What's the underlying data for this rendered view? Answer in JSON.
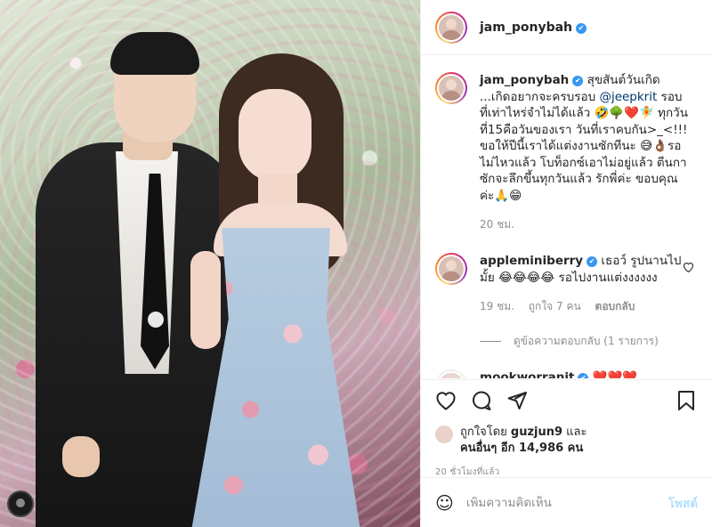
{
  "post": {
    "username": "jam_ponybah",
    "verified_mark": "✔"
  },
  "caption": {
    "username": "jam_ponybah",
    "text_before": " สุขสันต์วันเกิด ...เกิดอยากจะครบรอบ ",
    "mention": "@jeepkrit",
    "text_after": " รอบที่เท่าไหร่จำไม่ได้แล้ว 🤣🌳❤️🧚 ทุกวันที่15คือวันของเรา วันที่เราคบกัน>_<!!! ขอให้ปีนี้เราได้แต่งงานซักทีนะ 😅👌🏾รอไม่ไหวแล้ว โบท็อกซ์เอาไม่อยู่แล้ว ตีนกาซักจะลึกขึ้นทุกวันแล้ว รักพี่ค่ะ ขอบคุณค่ะ🙏😁",
    "time": "20 ชม."
  },
  "comments": [
    {
      "username": "appleminiberry",
      "text": " เธอว์ รูปนานไปมั้ย 😂😂😂😂 รอไปงานแต่งงงงงง",
      "time": "19 ชม.",
      "likes": "ถูกใจ 7 คน",
      "reply": "ตอบกลับ",
      "view_replies": "ดูข้อความตอบกลับ (1 รายการ)"
    },
    {
      "username": "mookworranit",
      "text": " ❤️❤️❤️"
    }
  ],
  "likes": {
    "prefix": "ถูกใจโดย ",
    "by_user": "guzjun9",
    "middle": " และ",
    "others": "คนอื่นๆ อีก 14,986 คน"
  },
  "timestamp": "20 ชั่วโมงที่แล้ว",
  "add_comment": {
    "placeholder": "เพิ่มความคิดเห็น",
    "emoji": "☺",
    "post_label": "โพสต์"
  },
  "icons": {
    "like": "heart-icon",
    "comment": "comment-icon",
    "share": "send-icon",
    "save": "bookmark-icon",
    "comment_like": "heart-icon"
  },
  "colors": {
    "verified": "#3897f0",
    "post_button": "#b2dffc",
    "mention": "#00376b",
    "heart_red": "#ed4956"
  }
}
